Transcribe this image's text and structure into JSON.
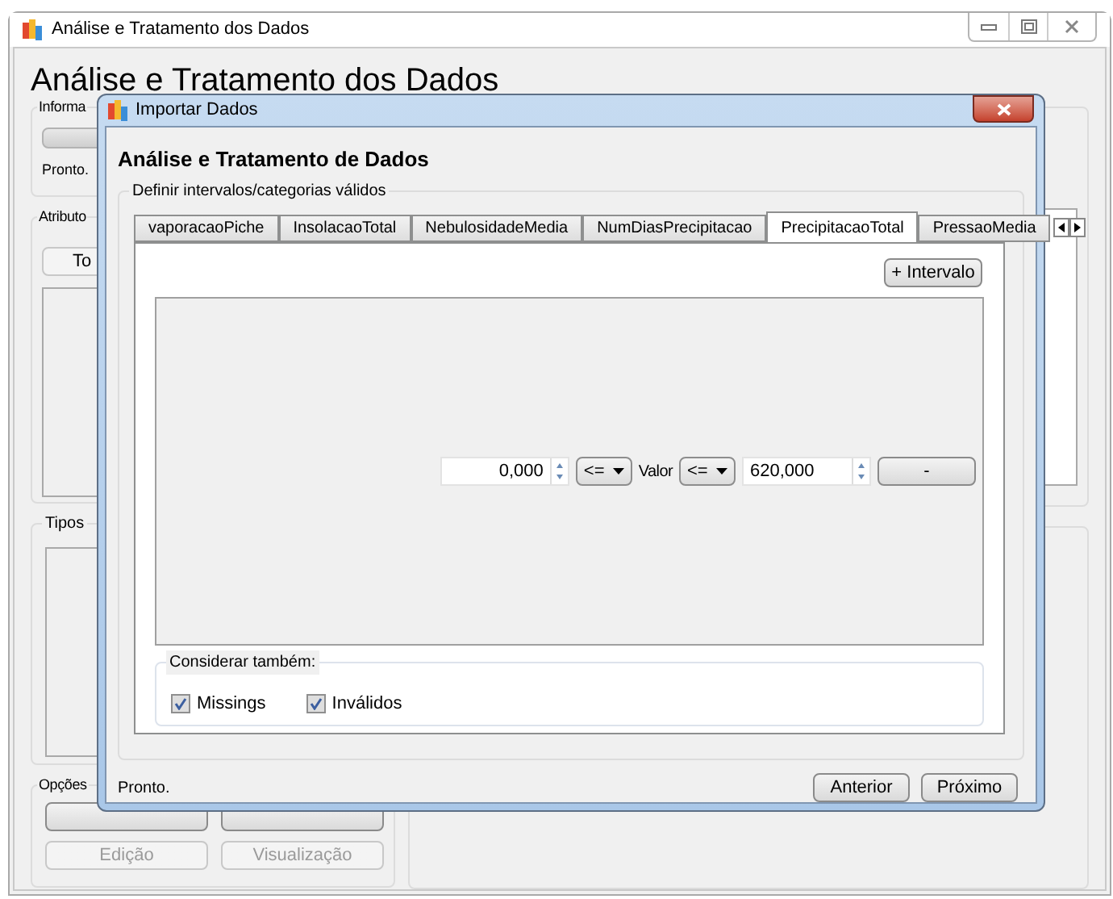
{
  "main_window": {
    "title": "Análise e Tratamento dos Dados",
    "heading": "Análise e Tratamento dos Dados",
    "info_group": {
      "label": "Informa",
      "status": "Pronto.",
      "progress": {
        "level": 0
      }
    },
    "attributes_group": {
      "label": "Atributo",
      "button": "To"
    },
    "types_group": {
      "label": "Tipos"
    },
    "options_group": {
      "label": "Opções",
      "buttons": [
        {
          "label": "Edição",
          "disabled": true
        },
        {
          "label": "Visualização",
          "disabled": true
        }
      ]
    }
  },
  "dialog": {
    "title": "Importar Dados",
    "heading": "Análise e Tratamento de Dados",
    "group_label": "Definir intervalos/categorias válidos",
    "tabs": [
      {
        "label": "vaporacaoPiche",
        "selected": false
      },
      {
        "label": "InsolacaoTotal",
        "selected": false
      },
      {
        "label": "NebulosidadeMedia",
        "selected": false
      },
      {
        "label": "NumDiasPrecipitacao",
        "selected": false
      },
      {
        "label": "PrecipitacaoTotal",
        "selected": true
      },
      {
        "label": "PressaoMedia",
        "selected": false
      }
    ],
    "add_button": "+ Intervalo",
    "interval": {
      "min_value": "0,000",
      "min_operator": "<=",
      "label": "Valor",
      "max_operator": "<=",
      "max_value": "620,000",
      "remove_button": "-"
    },
    "also_consider": {
      "label": "Considerar também:",
      "options": [
        {
          "label": "Missings",
          "checked": true
        },
        {
          "label": "Inválidos",
          "checked": true
        }
      ]
    },
    "status": "Pronto.",
    "buttons": [
      "Anterior",
      "Próximo"
    ]
  }
}
